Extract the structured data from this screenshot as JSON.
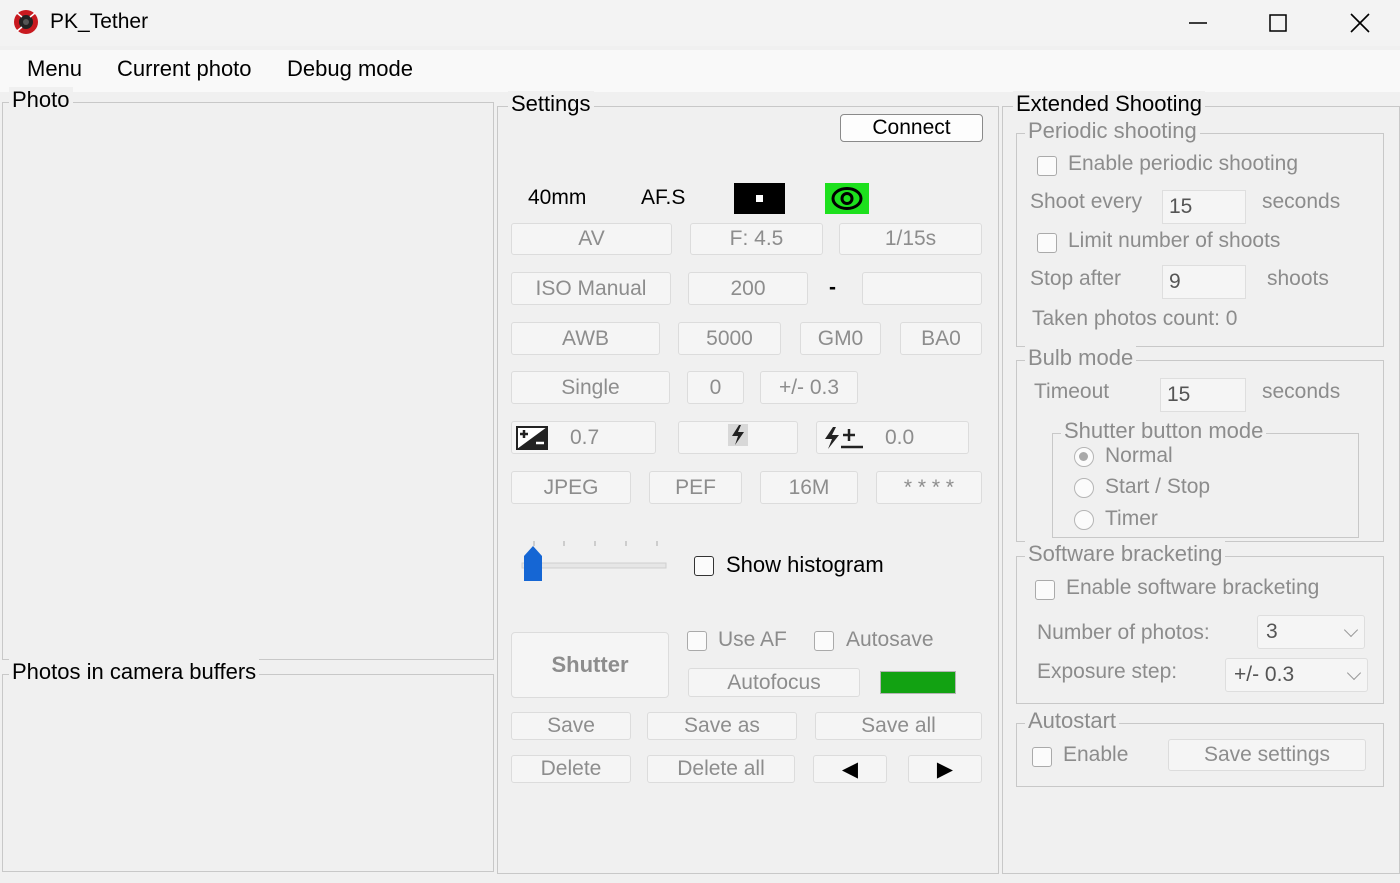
{
  "window": {
    "title": "PK_Tether"
  },
  "menu": [
    "Menu",
    "Current photo",
    "Debug mode"
  ],
  "photo_panel": {
    "title": "Photo",
    "buffers_title": "Photos in camera buffers"
  },
  "settings": {
    "title": "Settings",
    "connect": "Connect",
    "lens": "40mm",
    "af_mode": "AF.S",
    "exposure_mode": "AV",
    "aperture": "F: 4.5",
    "shutter_speed": "1/15s",
    "iso_mode": "ISO Manual",
    "iso_value": "200",
    "iso_separator": "-",
    "white_balance": "AWB",
    "color_temp": "5000",
    "gm_shift": "GM0",
    "ba_shift": "BA0",
    "drive_mode": "Single",
    "drive_value": "0",
    "bracket_step": "+/- 0.3",
    "exp_comp": "0.7",
    "flash_comp": "0.0",
    "file_format": "JPEG",
    "raw_format": "PEF",
    "resolution": "16M",
    "quality": "* * * *",
    "show_histogram": "Show histogram",
    "shutter": "Shutter",
    "use_af": "Use AF",
    "autosave": "Autosave",
    "autofocus": "Autofocus",
    "save": "Save",
    "save_as": "Save as",
    "save_all": "Save all",
    "delete": "Delete",
    "delete_all": "Delete all",
    "prev": "◀",
    "next": "▶",
    "status_color": "#12a212"
  },
  "extended": {
    "title": "Extended Shooting",
    "periodic": {
      "title": "Periodic shooting",
      "enable": "Enable periodic shooting",
      "shoot_every": "Shoot every",
      "shoot_every_value": "15",
      "seconds": "seconds",
      "limit": "Limit number of shoots",
      "stop_after": "Stop after",
      "stop_after_value": "9",
      "shoots": "shoots",
      "taken": "Taken photos count: 0"
    },
    "bulb": {
      "title": "Bulb mode",
      "timeout": "Timeout",
      "timeout_value": "15",
      "seconds": "seconds",
      "shutter_mode_title": "Shutter button mode",
      "normal": "Normal",
      "start_stop": "Start / Stop",
      "timer": "Timer"
    },
    "bracketing": {
      "title": "Software bracketing",
      "enable": "Enable software bracketing",
      "num_photos": "Number of photos:",
      "num_photos_value": "3",
      "exp_step": "Exposure step:",
      "exp_step_value": "+/- 0.3"
    },
    "autostart": {
      "title": "Autostart",
      "enable": "Enable",
      "save_settings": "Save settings"
    }
  }
}
